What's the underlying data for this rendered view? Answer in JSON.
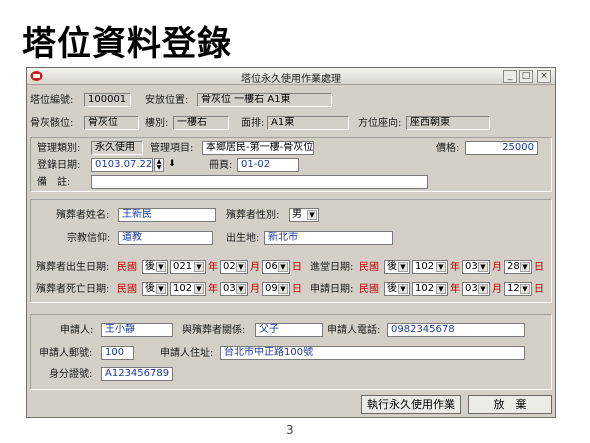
{
  "slide": {
    "title": "塔位資料登錄",
    "page_number": "3"
  },
  "window": {
    "title": "塔位永久使用作業處理",
    "min": "_",
    "max": "□",
    "close": "×"
  },
  "top": {
    "tower_no_label": "塔位編號:",
    "tower_no": "100001",
    "location_label": "安放位置:",
    "location": "骨灰位 一樓右 A1東",
    "category_label": "骨灰骸位:",
    "category": "骨灰位",
    "floor_label": "樓別:",
    "floor": "一樓右",
    "row_label": "面排:",
    "row": "A1東",
    "orientation_label": "方位座向:",
    "orientation": "座西朝東"
  },
  "manage": {
    "type_label": "管理類別:",
    "type": "永久使用",
    "item_label": "管理項目:",
    "item": "本鄉居民-第一樓-骨灰位",
    "price_label": "價格:",
    "price": "25000",
    "reg_date_label": "登錄日期:",
    "reg_date": "0103.07.22",
    "spin_up": "▲",
    "spin_down": "▼",
    "calendar": "⬇",
    "book_label": "冊頁:",
    "book": "01-02",
    "note_label": "備　註:",
    "note": ""
  },
  "deceased": {
    "name_label": "殯葬者姓名:",
    "name": "王新民",
    "gender_label": "殯葬者性別:",
    "gender": "男",
    "religion_label": "宗教信仰:",
    "religion": "道教",
    "birthplace_label": "出生地:",
    "birthplace": "新北市",
    "birth_label": "殯葬者出生日期:",
    "birth_era": "民國",
    "birth_pre": "後",
    "birth_y": "021",
    "birth_m": "02",
    "birth_d": "06",
    "enter_label": "進堂日期:",
    "enter_era": "民國",
    "enter_pre": "後",
    "enter_y": "102",
    "enter_m": "03",
    "enter_d": "28",
    "death_label": "殯葬者死亡日期:",
    "death_era": "民國",
    "death_pre": "後",
    "death_y": "102",
    "death_m": "03",
    "death_d": "09",
    "apply_label": "申請日期:",
    "apply_era": "民國",
    "apply_pre": "後",
    "apply_y": "102",
    "apply_m": "03",
    "apply_d": "12",
    "unit_y": "年",
    "unit_m": "月",
    "unit_d": "日",
    "arrow": "▼"
  },
  "applicant": {
    "name_label": "申請人:",
    "name": "王小靜",
    "relation_label": "與殯葬者關係:",
    "relation": "父子",
    "phone_label": "申請人電話:",
    "phone": "0982345678",
    "zip_label": "申請人郵號:",
    "zip": "100",
    "address_label": "申請人住址:",
    "address": "台北市中正路100號",
    "id_label": "身分證號:",
    "id": "A123456789"
  },
  "buttons": {
    "execute": "執行永久使用作業",
    "cancel": "放　棄"
  }
}
